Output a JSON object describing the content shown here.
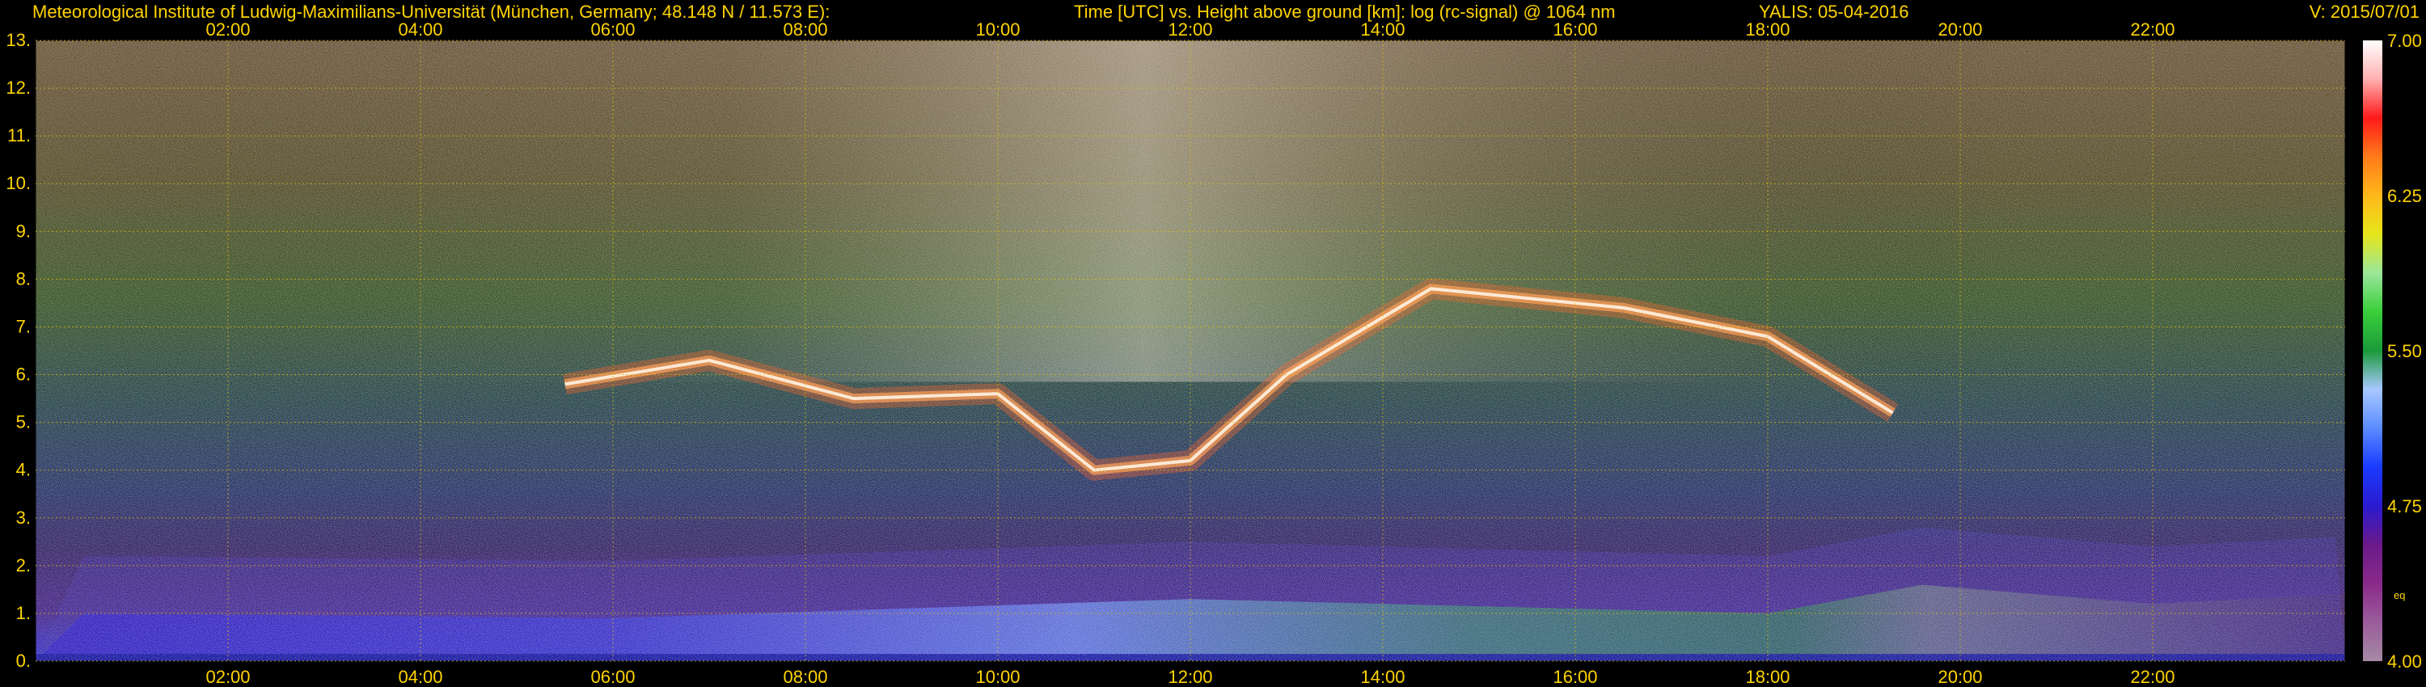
{
  "header": {
    "institute": "Meteorological Institute of Ludwig-Maximilians-Universität (München, Germany; 48.148 N / 11.573 E):",
    "plot_title": "Time [UTC] vs. Height above ground [km]: log (rc-signal) @ 1064 nm",
    "instrument_date": "YALIS: 05-04-2016",
    "version": "V: 2015/07/01"
  },
  "colors": {
    "background": "#000000",
    "text": "#ffd400",
    "grid": "#e6c200"
  },
  "chart_data": {
    "type": "heatmap",
    "title": "Time [UTC] vs. Height above ground [km]: log (rc-signal) @ 1064 nm",
    "xlabel": "",
    "ylabel": "",
    "x_range_hours": [
      0.0,
      24.0
    ],
    "x_ticks": [
      "02:00",
      "04:00",
      "06:00",
      "08:00",
      "10:00",
      "12:00",
      "14:00",
      "16:00",
      "18:00",
      "20:00",
      "22:00"
    ],
    "x_tick_hours": [
      2,
      4,
      6,
      8,
      10,
      12,
      14,
      16,
      18,
      20,
      22
    ],
    "ylim": [
      0,
      13
    ],
    "y_ticks": [
      "0.",
      "1.",
      "2.",
      "3.",
      "4.",
      "5.",
      "6.",
      "7.",
      "8.",
      "9.",
      "10.",
      "11.",
      "12.",
      "13."
    ],
    "grid": true,
    "colorbar": {
      "range": [
        4.0,
        7.0
      ],
      "tick_labels": [
        "7.00",
        "6.25",
        "5.50",
        "4.75",
        "4.00"
      ],
      "tick_values": [
        7.0,
        6.25,
        5.5,
        4.75,
        4.0
      ],
      "annotation": "eq",
      "colors": [
        "#a58aa5",
        "#9a5c9a",
        "#8a2a8a",
        "#6a1a8a",
        "#2a1acf",
        "#1a3aff",
        "#5a8cff",
        "#a8c8ff",
        "#1a9a3a",
        "#3acf3a",
        "#9ae69a",
        "#e6e61a",
        "#ffb81a",
        "#ff7a1a",
        "#ff1a1a",
        "#ffb0b0",
        "#ffffff"
      ]
    },
    "cloud_base_km": [
      {
        "hour": 5.5,
        "km": 5.8
      },
      {
        "hour": 7.0,
        "km": 6.3
      },
      {
        "hour": 8.5,
        "km": 5.5
      },
      {
        "hour": 10.0,
        "km": 5.6
      },
      {
        "hour": 11.0,
        "km": 4.0
      },
      {
        "hour": 12.0,
        "km": 4.2
      },
      {
        "hour": 13.0,
        "km": 6.0
      },
      {
        "hour": 14.5,
        "km": 7.8
      },
      {
        "hour": 16.5,
        "km": 7.4
      },
      {
        "hour": 18.0,
        "km": 6.8
      },
      {
        "hour": 19.3,
        "km": 5.2
      }
    ],
    "boundary_layer_top_km": [
      {
        "hour": 0.5,
        "km": 1.0
      },
      {
        "hour": 6.0,
        "km": 0.9
      },
      {
        "hour": 12.0,
        "km": 1.3
      },
      {
        "hour": 18.0,
        "km": 1.0
      },
      {
        "hour": 19.6,
        "km": 1.6
      },
      {
        "hour": 22.0,
        "km": 1.2
      },
      {
        "hour": 23.9,
        "km": 1.4
      }
    ]
  }
}
